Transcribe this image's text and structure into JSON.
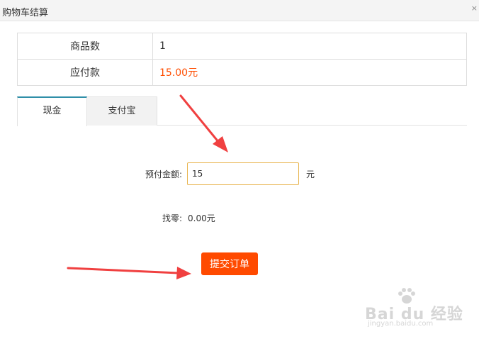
{
  "window": {
    "title": "购物车结算",
    "close_glyph": "×"
  },
  "summary": {
    "rows": [
      {
        "label": "商品数",
        "value": "1"
      },
      {
        "label": "应付款",
        "value": "15.00元"
      }
    ]
  },
  "tabs": [
    {
      "label": "现金",
      "active": true
    },
    {
      "label": "支付宝",
      "active": false
    }
  ],
  "form": {
    "prepaid_label": "预付金额:",
    "prepaid_value": "15",
    "unit": "元",
    "change_label": "找零:",
    "change_value": "0.00元",
    "submit_label": "提交订单"
  },
  "watermark": {
    "text": "Bai du 经验",
    "sub": "jingyan.baidu.com"
  },
  "colors": {
    "accent": "#ff4a00",
    "price": "#ff4d00",
    "tab_active_border": "#2f8fa8",
    "input_border": "#e8b44e",
    "arrow": "#f04040"
  },
  "icons": {
    "close": "close-icon",
    "watermark_logo": "baidu-paw-icon"
  }
}
